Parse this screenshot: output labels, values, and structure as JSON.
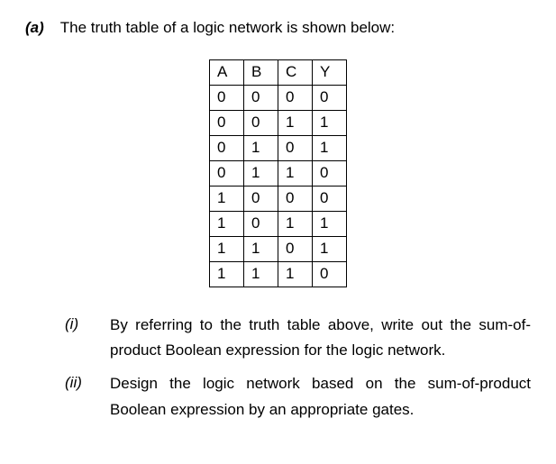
{
  "part_label": "(a)",
  "intro": "The truth table of a logic network is shown below:",
  "chart_data": {
    "type": "table",
    "headers": [
      "A",
      "B",
      "C",
      "Y"
    ],
    "rows": [
      [
        "0",
        "0",
        "0",
        "0"
      ],
      [
        "0",
        "0",
        "1",
        "1"
      ],
      [
        "0",
        "1",
        "0",
        "1"
      ],
      [
        "0",
        "1",
        "1",
        "0"
      ],
      [
        "1",
        "0",
        "0",
        "0"
      ],
      [
        "1",
        "0",
        "1",
        "1"
      ],
      [
        "1",
        "1",
        "0",
        "1"
      ],
      [
        "1",
        "1",
        "1",
        "0"
      ]
    ]
  },
  "questions": [
    {
      "label": "(i)",
      "text": "By referring to the truth table above, write out the sum-of-product Boolean expression for the logic network."
    },
    {
      "label": "(ii)",
      "text": "Design the logic network based on the sum-of-product Boolean expression by an appropriate gates."
    }
  ]
}
